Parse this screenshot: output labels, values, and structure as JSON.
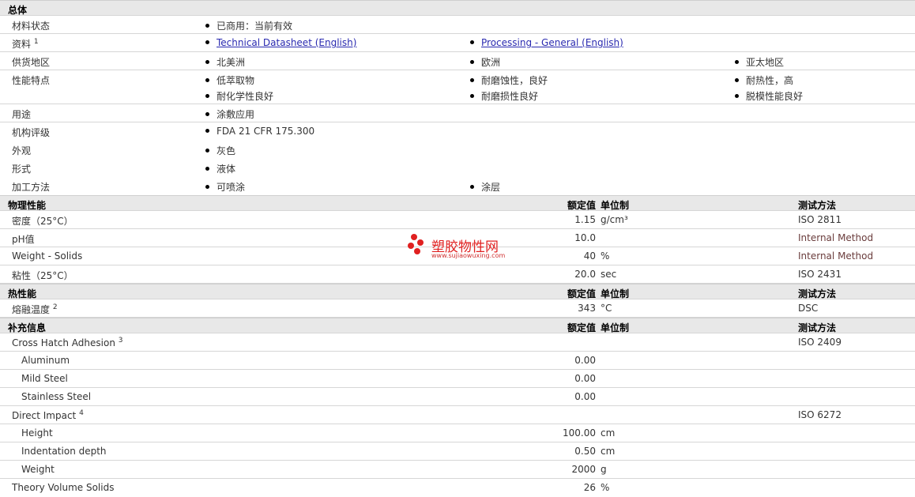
{
  "general": {
    "header": "总体",
    "material_status": {
      "label": "材料状态",
      "value": "已商用：当前有效"
    },
    "docs": {
      "label": "资料",
      "sup": "1",
      "link1": "Technical Datasheet (English)",
      "link2": "Processing - General (English)"
    },
    "regions": {
      "label": "供货地区",
      "v1": "北美洲",
      "v2": "欧洲",
      "v3": "亚太地区"
    },
    "features": {
      "label": "性能特点",
      "v1": "低萃取物",
      "v2": "耐磨蚀性，良好",
      "v3": "耐热性，高",
      "v4": "耐化学性良好",
      "v5": "耐磨损性良好",
      "v6": "脱模性能良好"
    },
    "uses": {
      "label": "用途",
      "value": "涂敷应用"
    },
    "agency": {
      "label": "机构评级",
      "value": "FDA 21 CFR 175.300"
    },
    "appearance": {
      "label": "外观",
      "value": "灰色"
    },
    "form": {
      "label": "形式",
      "value": "液体"
    },
    "processing": {
      "label": "加工方法",
      "v1": "可喷涂",
      "v2": "涂层"
    }
  },
  "col_headers": {
    "nominal": "额定值",
    "unit": "单位制",
    "test": "测试方法"
  },
  "physical": {
    "header": "物理性能",
    "rows": [
      {
        "label": "密度（25°C）",
        "value": "1.15",
        "unit": "g/cm³",
        "test": "ISO 2811"
      },
      {
        "label": "pH值",
        "value": "10.0",
        "unit": "",
        "test": "Internal Method"
      },
      {
        "label": "Weight - Solids",
        "value": "40",
        "unit": "%",
        "test": "Internal Method"
      },
      {
        "label": "粘性（25°C）",
        "value": "20.0",
        "unit": "sec",
        "test": "ISO 2431"
      }
    ]
  },
  "thermal": {
    "header": "热性能",
    "row": {
      "label": "熔融温度",
      "sup": "2",
      "value": "343",
      "unit": "°C",
      "test": "DSC"
    }
  },
  "extra": {
    "header": "补充信息",
    "cross_hatch": {
      "label": "Cross Hatch Adhesion",
      "sup": "3",
      "test": "ISO 2409"
    },
    "ch_rows": [
      {
        "label": "Aluminum",
        "value": "0.00"
      },
      {
        "label": "Mild Steel",
        "value": "0.00"
      },
      {
        "label": "Stainless Steel",
        "value": "0.00"
      }
    ],
    "impact": {
      "label": "Direct Impact",
      "sup": "4",
      "test": "ISO 6272"
    },
    "impact_rows": [
      {
        "label": "Height",
        "value": "100.00",
        "unit": "cm"
      },
      {
        "label": "Indentation depth",
        "value": "0.50",
        "unit": "cm"
      },
      {
        "label": "Weight",
        "value": "2000",
        "unit": "g"
      }
    ],
    "theory": {
      "label": "Theory Volume Solids",
      "value": "26",
      "unit": "%"
    }
  },
  "watermark": {
    "title": "塑胶物性网",
    "url": "www.sujiaowuxing.com"
  }
}
